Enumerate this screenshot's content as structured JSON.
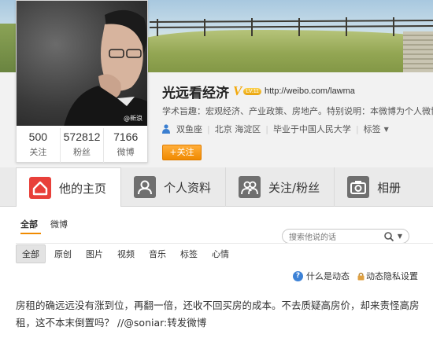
{
  "profile": {
    "name": "光远看经济",
    "verified_mark": "V",
    "level": "LV.11",
    "url": "http://weibo.com/lawma",
    "intro": "学术旨趣：宏观经济、产业政策、房地产。特别说明：本微博为个人微博",
    "watermark": "@新浪",
    "meta": {
      "constellation": "双鱼座",
      "location": "北京 海淀区",
      "school": "毕业于中国人民大学",
      "tags": "标签"
    },
    "follow_button": "+关注",
    "stats": [
      {
        "value": "500",
        "label": "关注"
      },
      {
        "value": "572812",
        "label": "粉丝"
      },
      {
        "value": "7166",
        "label": "微博"
      }
    ]
  },
  "tabs": [
    {
      "label": "他的主页",
      "icon": "home-icon",
      "active": true
    },
    {
      "label": "个人资料",
      "icon": "profile-icon",
      "active": false
    },
    {
      "label": "关注/粉丝",
      "icon": "followers-icon",
      "active": false
    },
    {
      "label": "相册",
      "icon": "camera-icon",
      "active": false
    }
  ],
  "feed": {
    "tabs": [
      "全部",
      "微博"
    ],
    "search_placeholder": "搜索他说的话",
    "filters": [
      "全部",
      "原创",
      "图片",
      "视频",
      "音乐",
      "标签",
      "心情"
    ],
    "help_link": "什么是动态",
    "privacy_link": "动态隐私设置",
    "post_text": "房租的确远远没有涨到位，再翻一倍，还收不回买房的成本。不去质疑高房价，却来责怪高房租，这不本末倒置吗？ //",
    "post_mention": "@soniar",
    "post_tail": ":转发微博"
  },
  "colors": {
    "accent_orange": "#f08a00",
    "tab_home_red": "#e8403a",
    "tab_grey": "#6f6f6f"
  }
}
